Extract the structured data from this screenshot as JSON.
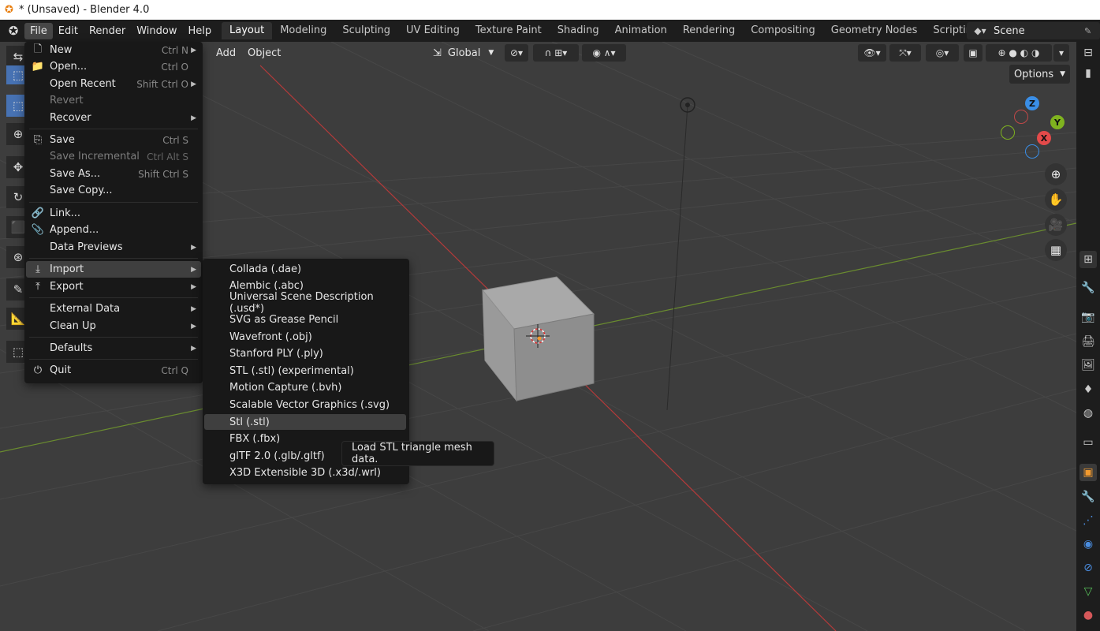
{
  "window": {
    "title": "* (Unsaved) - Blender 4.0"
  },
  "menubar": {
    "items": [
      "File",
      "Edit",
      "Render",
      "Window",
      "Help"
    ],
    "active": "File"
  },
  "workspaces": {
    "tabs": [
      "Layout",
      "Modeling",
      "Sculpting",
      "UV Editing",
      "Texture Paint",
      "Shading",
      "Animation",
      "Rendering",
      "Compositing",
      "Geometry Nodes",
      "Scripting"
    ],
    "active": "Layout",
    "add": "+"
  },
  "scene": {
    "name": "Scene"
  },
  "viewport_header": {
    "add": "Add",
    "object": "Object",
    "transform_orientation": "Global",
    "options": "Options"
  },
  "gizmo": {
    "x": "X",
    "y": "Y",
    "z": "Z"
  },
  "file_menu": {
    "items": [
      {
        "label": "New",
        "shortcut": "Ctrl N",
        "submenu": true,
        "icon": "new-file-icon"
      },
      {
        "label": "Open...",
        "shortcut": "Ctrl O",
        "icon": "folder-icon"
      },
      {
        "label": "Open Recent",
        "shortcut": "Shift Ctrl O",
        "submenu": true
      },
      {
        "label": "Revert",
        "disabled": true
      },
      {
        "label": "Recover",
        "submenu": true
      },
      {
        "label": "Save",
        "shortcut": "Ctrl S",
        "icon": "save-icon"
      },
      {
        "label": "Save Incremental",
        "shortcut": "Ctrl Alt S",
        "disabled": true
      },
      {
        "label": "Save As...",
        "shortcut": "Shift Ctrl S"
      },
      {
        "label": "Save Copy..."
      },
      {
        "label": "Link...",
        "icon": "link-icon"
      },
      {
        "label": "Append...",
        "icon": "append-icon"
      },
      {
        "label": "Data Previews",
        "submenu": true
      },
      {
        "label": "Import",
        "submenu": true,
        "icon": "import-icon",
        "highlighted": true
      },
      {
        "label": "Export",
        "submenu": true,
        "icon": "export-icon"
      },
      {
        "label": "External Data",
        "submenu": true
      },
      {
        "label": "Clean Up",
        "submenu": true
      },
      {
        "label": "Defaults",
        "submenu": true
      },
      {
        "label": "Quit",
        "shortcut": "Ctrl Q",
        "icon": "power-icon"
      }
    ]
  },
  "import_menu": {
    "items": [
      "Collada (.dae)",
      "Alembic (.abc)",
      "Universal Scene Description (.usd*)",
      "SVG as Grease Pencil",
      "Wavefront (.obj)",
      "Stanford PLY (.ply)",
      "STL (.stl) (experimental)",
      "Motion Capture (.bvh)",
      "Scalable Vector Graphics (.svg)",
      "Stl (.stl)",
      "FBX (.fbx)",
      "glTF 2.0 (.glb/.gltf)",
      "X3D Extensible 3D (.x3d/.wrl)"
    ],
    "highlighted": "Stl (.stl)"
  },
  "tooltip": {
    "text": "Load STL triangle mesh data."
  }
}
